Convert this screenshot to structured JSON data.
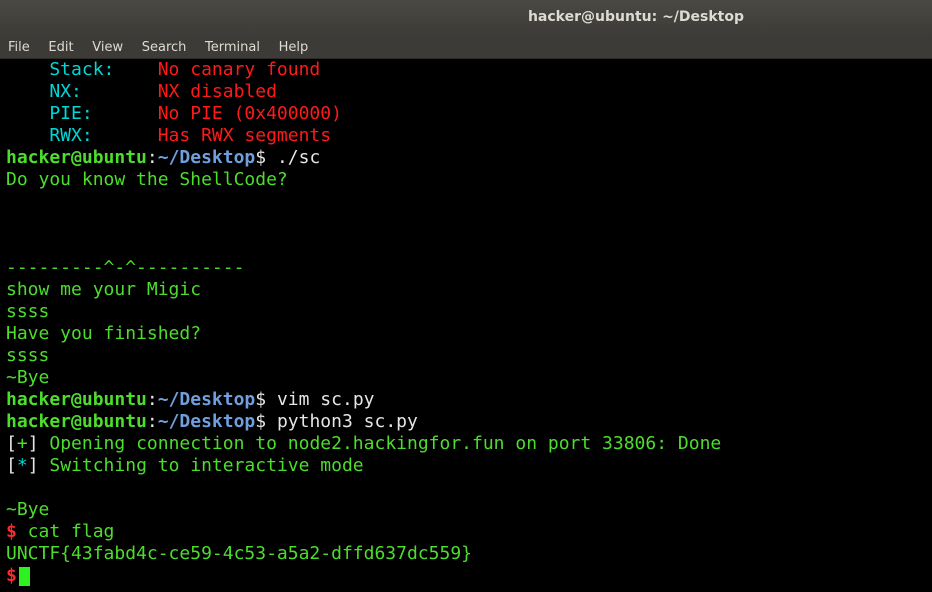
{
  "window": {
    "title": "hacker@ubuntu: ~/Desktop"
  },
  "menu": [
    "File",
    "Edit",
    "View",
    "Search",
    "Terminal",
    "Help"
  ],
  "prompt": {
    "user": "hacker@ubuntu",
    "sep": ":",
    "path": "~/Desktop",
    "symbol": "$"
  },
  "checksec": [
    {
      "label": "    Stack:    ",
      "value": "No canary found"
    },
    {
      "label": "    NX:       ",
      "value": "NX disabled"
    },
    {
      "label": "    PIE:      ",
      "value": "No PIE (0x400000)"
    },
    {
      "label": "    RWX:      ",
      "value": "Has RWX segments"
    }
  ],
  "cmd1": " ./sc",
  "out1": [
    "Do you know the ShellCode?",
    "",
    "",
    "",
    "---------^-^----------",
    "show me your Migic",
    "ssss",
    "Have you finished?",
    "ssss",
    "~Bye"
  ],
  "cmd2": " vim sc.py",
  "cmd3": " python3 sc.py",
  "pwn": [
    {
      "mark": "+",
      "text": " Opening connection to node2.hackingfor.fun on port 33806: Done"
    },
    {
      "mark": "*",
      "text": " Switching to interactive mode"
    }
  ],
  "out2": [
    "",
    "~Bye"
  ],
  "shell_prompt": "$",
  "cmd4": " cat flag",
  "flag": "UNCTF{43fabd4c-ce59-4c53-a5a2-dffd637dc559}"
}
